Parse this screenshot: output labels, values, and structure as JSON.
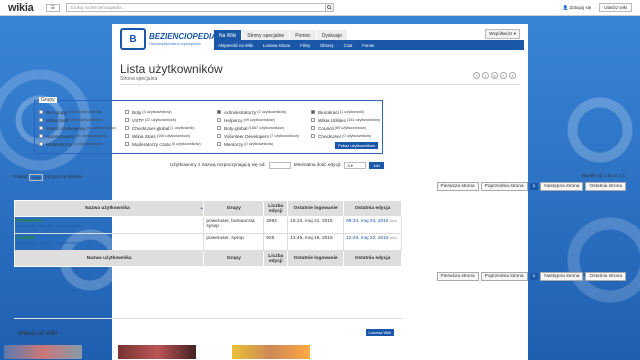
{
  "global_nav": {
    "logo": "wikia",
    "search_placeholder": "Szukaj na Bezienciopedia...",
    "login_label": "Zaloguj się",
    "create_label": "Utwórz wiki"
  },
  "wiki": {
    "wordmark": "BEZIENCIOPEDIA",
    "tagline": "Humanybpedia-encyklopedia",
    "tabs": [
      "Na Wiki",
      "Strony specjalne",
      "Pomoc",
      "Dyskusje"
    ],
    "subnav": [
      "Aktywność na Wiki",
      "Losowa strona",
      "Filmy",
      "Obrazy",
      "Czat",
      "Forum"
    ],
    "contribute_label": "Współtwórz"
  },
  "page": {
    "title": "Lista użytkowników",
    "subtitle": "Strona specjalna",
    "share": [
      "f",
      "t",
      "g",
      "r",
      "s"
    ]
  },
  "groups": {
    "legend": "Grupy",
    "columns": [
      [
        {
          "label": "Bez grupy",
          "count": "(249 użytkowników)",
          "checked": false
        },
        {
          "label": "Wikia Staff",
          "count": "(266 użytkowników)",
          "checked": false
        },
        {
          "label": "Stanić użytkownicy",
          "count": "(6 użytkowników)",
          "checked": false
        },
        {
          "label": "Autoryzowani",
          "count": "(46 użytkowników)",
          "checked": false
        },
        {
          "label": "Moderatorzy",
          "count": "(0 użytkowników)",
          "checked": false
        }
      ],
      [
        {
          "label": "Boty",
          "count": "(4 użytkowników)",
          "checked": false
        },
        {
          "label": "VSTF",
          "count": "(22 użytkowników)",
          "checked": false
        },
        {
          "label": "CheckUser-global",
          "count": "(1 użytkownik)",
          "checked": false
        },
        {
          "label": "Wikia Stars",
          "count": "(106 użytkowników)",
          "checked": false
        },
        {
          "label": "Moderatorzy czatu",
          "count": "(0 użytkowników)",
          "checked": false
        }
      ],
      [
        {
          "label": "Administratorzy",
          "count": "(2 użytkowników)",
          "checked": true
        },
        {
          "label": "Helpercy",
          "count": "(49 użytkowników)",
          "checked": false
        },
        {
          "label": "Boty-global",
          "count": "(1667 użytkowników)",
          "checked": false
        },
        {
          "label": "Volunteer Developers",
          "count": "(7 użytkowników)",
          "checked": false
        },
        {
          "label": "Mentorzy",
          "count": "(0 użytkowników)",
          "checked": false
        }
      ],
      [
        {
          "label": "Biurokraci",
          "count": "(1 użytkownik)",
          "checked": true
        },
        {
          "label": "Wikia Utilities",
          "count": "(151 użytkowników)",
          "checked": false
        },
        {
          "label": "Council",
          "count": "(69 użytkowników)",
          "checked": false
        },
        {
          "label": "CheckUser",
          "count": "(0 użytkowników)",
          "checked": false
        }
      ]
    ],
    "show_button": "Pokaż użytkowników"
  },
  "filter": {
    "name_prefix_label": "Użytkownicy z nazwą rozpoczynającą się od:",
    "min_edits_label": "Minimalna ilość edycji:",
    "min_edits_value": "5",
    "submit_label": "Idźi"
  },
  "perpage": {
    "prefix": "Pokaż",
    "value": "10",
    "suffix": "pozycji na stronie"
  },
  "results_info": "Wyniki od 1 do 2 z 2.",
  "pager": {
    "first": "Pierwsza strona",
    "prev": "Poprzednia strona",
    "current": "1",
    "next": "Następna strona",
    "last": "Ostatnia strona"
  },
  "table": {
    "headers": [
      "Nazwa użytkownika",
      "Grupy",
      "Liczba edycji",
      "Ostatnie logowanie",
      "Ostatnia edycja"
    ],
    "rows": [
      {
        "name": "Damian102",
        "tools": "(Dyskusja) · (Edycje) · (Licznik edycji)",
        "groups": "poweruser, bureaucrat, sysop",
        "edits": "2992",
        "last_login": "15:13, maj 21, 2015",
        "last_edit": "09:34, maj 23, 2015",
        "diff": "różn"
      },
      {
        "name": "Lw1995",
        "tools": "(Dyskusja) · (Edycje) · (Licznik edycji)",
        "groups": "poweruser, sysop",
        "edits": "925",
        "last_login": "13:45, maj 16, 2015",
        "last_edit": "12:49, maj 22, 2015",
        "diff": "różn"
      }
    ]
  },
  "more": {
    "title": "Więcej od Wiki",
    "button": "Losowa Wiki"
  }
}
